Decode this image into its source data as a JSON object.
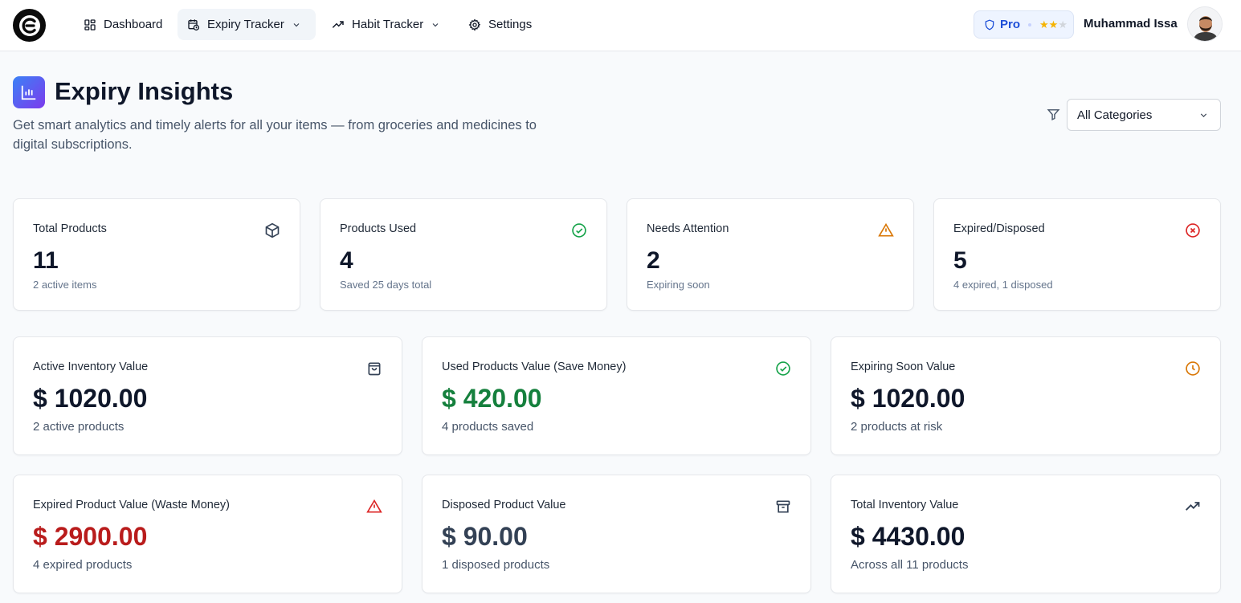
{
  "nav": {
    "dashboard": "Dashboard",
    "expiry_tracker": "Expiry Tracker",
    "habit_tracker": "Habit Tracker",
    "settings": "Settings"
  },
  "account": {
    "plan": "Pro",
    "stars_filled": 2,
    "stars_total": 3,
    "user_name": "Muhammad Issa"
  },
  "page": {
    "title": "Expiry Insights",
    "subtitle": "Get smart analytics and timely alerts for all your items — from groceries and medicines to digital subscriptions.",
    "category_filter": "All Categories"
  },
  "stats": [
    {
      "label": "Total Products",
      "value": "11",
      "sub": "2 active items",
      "icon": "box-icon"
    },
    {
      "label": "Products Used",
      "value": "4",
      "sub": "Saved 25 days total",
      "icon": "check-circle-icon"
    },
    {
      "label": "Needs Attention",
      "value": "2",
      "sub": "Expiring soon",
      "icon": "warning-icon"
    },
    {
      "label": "Expired/Disposed",
      "value": "5",
      "sub": "4 expired, 1 disposed",
      "icon": "x-circle-icon"
    }
  ],
  "values": [
    {
      "label": "Active Inventory Value",
      "value": "$ 1020.00",
      "sub": "2 active products",
      "icon": "shopping-bag-icon"
    },
    {
      "label": "Used Products Value (Save Money)",
      "value": "$ 420.00",
      "sub": "4 products saved",
      "icon": "check-circle-icon"
    },
    {
      "label": "Expiring Soon Value",
      "value": "$ 1020.00",
      "sub": "2 products at risk",
      "icon": "clock-icon"
    },
    {
      "label": "Expired Product Value (Waste Money)",
      "value": "$ 2900.00",
      "sub": "4 expired products",
      "icon": "warning-icon"
    },
    {
      "label": "Disposed Product Value",
      "value": "$ 90.00",
      "sub": "1 disposed products",
      "icon": "archive-icon"
    },
    {
      "label": "Total Inventory Value",
      "value": "$ 4430.00",
      "sub": "Across all 11 products",
      "icon": "trending-up-icon"
    }
  ],
  "colors": {
    "saved_green": "#15803d",
    "waste_red": "#b91c1c",
    "warning_amber": "#d97706",
    "success_green": "#16a34a",
    "danger_red": "#dc2626",
    "brand_blue": "#1d4ed8",
    "star_gold": "#f5b301"
  }
}
